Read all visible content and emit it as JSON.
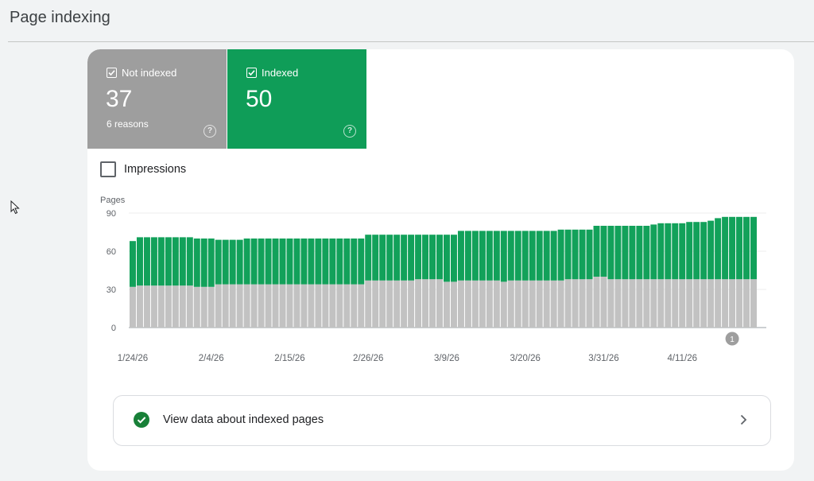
{
  "page": {
    "title": "Page indexing"
  },
  "metrics": {
    "not_indexed": {
      "label": "Not indexed",
      "count": "37",
      "sub": "6 reasons",
      "color": "#9e9e9e"
    },
    "indexed": {
      "label": "Indexed",
      "count": "50",
      "color": "#0f9d58"
    }
  },
  "impressions": {
    "label": "Impressions"
  },
  "chart_data": {
    "type": "bar",
    "stacked": true,
    "ylabel": "Pages",
    "ylim": [
      0,
      90
    ],
    "yticks": [
      0,
      30,
      60,
      90
    ],
    "xtick_labels": [
      "1/24/26",
      "2/4/26",
      "2/15/26",
      "2/26/26",
      "3/9/26",
      "3/20/26",
      "3/31/26",
      "4/11/26"
    ],
    "x": [
      "1/24/26",
      "1/25/26",
      "1/26/26",
      "1/27/26",
      "1/28/26",
      "1/29/26",
      "1/30/26",
      "1/31/26",
      "2/1/26",
      "2/2/26",
      "2/3/26",
      "2/4/26",
      "2/5/26",
      "2/6/26",
      "2/7/26",
      "2/8/26",
      "2/9/26",
      "2/10/26",
      "2/11/26",
      "2/12/26",
      "2/13/26",
      "2/14/26",
      "2/15/26",
      "2/16/26",
      "2/17/26",
      "2/18/26",
      "2/19/26",
      "2/20/26",
      "2/21/26",
      "2/22/26",
      "2/23/26",
      "2/24/26",
      "2/25/26",
      "2/26/26",
      "2/27/26",
      "2/28/26",
      "3/1/26",
      "3/2/26",
      "3/3/26",
      "3/4/26",
      "3/5/26",
      "3/6/26",
      "3/7/26",
      "3/8/26",
      "3/9/26",
      "3/10/26",
      "3/11/26",
      "3/12/26",
      "3/13/26",
      "3/14/26",
      "3/15/26",
      "3/16/26",
      "3/17/26",
      "3/18/26",
      "3/19/26",
      "3/20/26",
      "3/21/26",
      "3/22/26",
      "3/23/26",
      "3/24/26",
      "3/25/26",
      "3/26/26",
      "3/27/26",
      "3/28/26",
      "3/29/26",
      "3/30/26",
      "3/31/26",
      "4/1/26",
      "4/2/26",
      "4/3/26",
      "4/4/26",
      "4/5/26",
      "4/6/26",
      "4/7/26",
      "4/8/26",
      "4/9/26",
      "4/10/26",
      "4/11/26",
      "4/12/26",
      "4/13/26",
      "4/14/26",
      "4/15/26",
      "4/16/26",
      "4/17/26",
      "4/18/26",
      "4/19/26",
      "4/20/26",
      "4/21/26"
    ],
    "series": [
      {
        "name": "Not indexed",
        "color": "#c2c2c2",
        "values": [
          32,
          33,
          33,
          33,
          33,
          33,
          33,
          33,
          33,
          32,
          32,
          32,
          34,
          34,
          34,
          34,
          34,
          34,
          34,
          34,
          34,
          34,
          34,
          34,
          34,
          34,
          34,
          34,
          34,
          34,
          34,
          34,
          34,
          37,
          37,
          37,
          37,
          37,
          37,
          37,
          38,
          38,
          38,
          38,
          36,
          36,
          37,
          37,
          37,
          37,
          37,
          37,
          36,
          37,
          37,
          37,
          37,
          37,
          37,
          37,
          37,
          38,
          38,
          38,
          38,
          40,
          40,
          38,
          38,
          38,
          38,
          38,
          38,
          38,
          38,
          38,
          38,
          38,
          38,
          38,
          38,
          38,
          38,
          38,
          38,
          38,
          38,
          38
        ]
      },
      {
        "name": "Indexed",
        "color": "#12a15a",
        "values": [
          36,
          38,
          38,
          38,
          38,
          38,
          38,
          38,
          38,
          38,
          38,
          38,
          35,
          35,
          35,
          35,
          36,
          36,
          36,
          36,
          36,
          36,
          36,
          36,
          36,
          36,
          36,
          36,
          36,
          36,
          36,
          36,
          36,
          36,
          36,
          36,
          36,
          36,
          36,
          36,
          35,
          35,
          35,
          35,
          37,
          37,
          39,
          39,
          39,
          39,
          39,
          39,
          40,
          39,
          39,
          39,
          39,
          39,
          39,
          39,
          40,
          39,
          39,
          39,
          39,
          40,
          40,
          42,
          42,
          42,
          42,
          42,
          42,
          43,
          44,
          44,
          44,
          44,
          45,
          45,
          45,
          46,
          48,
          49,
          49,
          49,
          49,
          49
        ]
      }
    ],
    "annotation": {
      "label": "1",
      "at": "4/18/26"
    }
  },
  "view_link": {
    "label": "View data about indexed pages"
  }
}
